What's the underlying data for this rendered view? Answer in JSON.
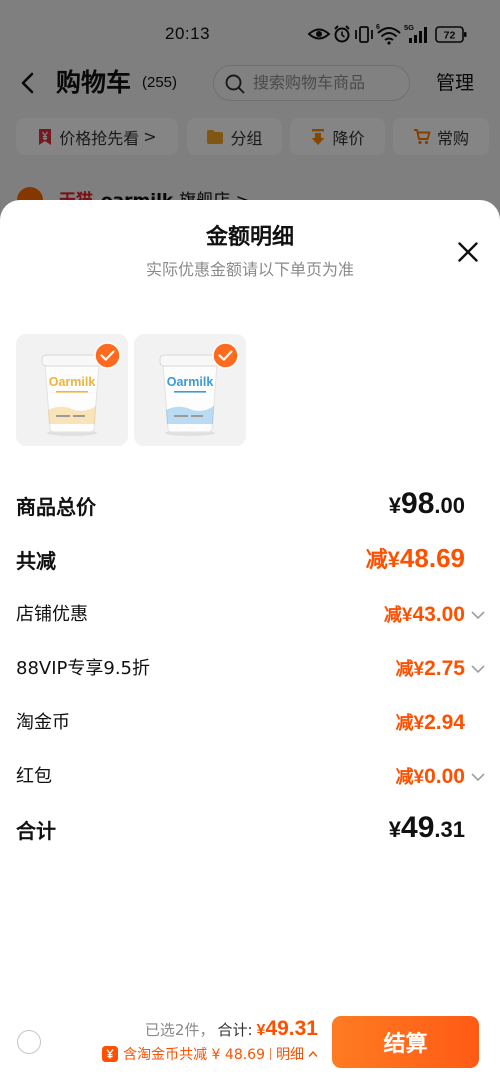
{
  "status_bar": {
    "time": "20:13",
    "wifi_badge": "6",
    "network": "5G",
    "battery": "72"
  },
  "header": {
    "title": "购物车",
    "count": "(255)",
    "search_placeholder": "搜索购物车商品",
    "manage_label": "管理"
  },
  "filters": [
    {
      "label": "价格抢先看",
      "suffix": ">",
      "icon": "price-tag-icon"
    },
    {
      "label": "分组",
      "icon": "folder-icon"
    },
    {
      "label": "降价",
      "icon": "price-drop-icon"
    },
    {
      "label": "常购",
      "icon": "cart-icon"
    }
  ],
  "store": {
    "platform": "天猫",
    "name": "oarmilk",
    "suffix": "旗舰店 >"
  },
  "sheet": {
    "title": "金额明细",
    "subtitle": "实际优惠金额请以下单页为准",
    "close_icon": "close-icon",
    "products": [
      {
        "brand": "Oarmilk",
        "selected": true,
        "accent": "#f0b43c"
      },
      {
        "brand": "Oarmilk",
        "selected": true,
        "accent": "#3b9ad9"
      }
    ],
    "rows": [
      {
        "label": "商品总价",
        "prefix": "",
        "currency": "¥",
        "integer": "98",
        "decimal": ".00",
        "expandable": false
      },
      {
        "label": "共减",
        "prefix": "减",
        "currency": "¥",
        "integer": "48",
        "decimal": ".69",
        "expandable": false
      },
      {
        "label": "店铺优惠",
        "prefix": "减",
        "currency": "¥",
        "integer": "43",
        "decimal": ".00",
        "expandable": true
      },
      {
        "label": "88VIP专享9.5折",
        "prefix": "减",
        "currency": "¥",
        "integer": "2",
        "decimal": ".75",
        "expandable": true
      },
      {
        "label": "淘金币",
        "prefix": "减",
        "currency": "¥",
        "integer": "2",
        "decimal": ".94",
        "expandable": false
      },
      {
        "label": "红包",
        "prefix": "减",
        "currency": "¥",
        "integer": "0",
        "decimal": ".00",
        "expandable": true
      },
      {
        "label": "合计",
        "prefix": "",
        "currency": "¥",
        "integer": "49",
        "decimal": ".31",
        "expandable": false
      }
    ]
  },
  "footer": {
    "selected_text": "已选2件，",
    "total_label": "合计:",
    "total_currency": "¥",
    "total_value": "49.31",
    "coin_note": "含淘金币共减 ¥ 48.69",
    "detail_label": "明细",
    "checkout_label": "结算"
  },
  "colors": {
    "accent": "#ff5000"
  }
}
